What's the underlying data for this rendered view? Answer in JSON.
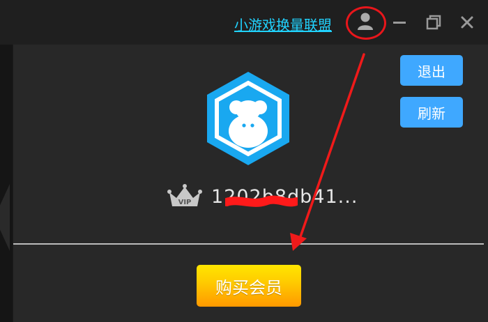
{
  "header": {
    "link_text": "小游戏换量联盟",
    "buttons": {
      "user_icon": "user-icon",
      "minimize_icon": "minimize-icon",
      "restore_icon": "restore-icon",
      "close_icon": "close-icon"
    }
  },
  "panel": {
    "avatar_icon": "monkey-hexagon-avatar",
    "logout_label": "退出",
    "refresh_label": "刷新",
    "vip_badge": "VIP",
    "username": "1202b8db41...",
    "buy_label": "购买会员"
  },
  "colors": {
    "link": "#21d3ff",
    "blue_button": "#3fa8ff",
    "buy_gradient_top": "#ffe600",
    "buy_gradient_bottom": "#ff9900",
    "annotation": "#e8161b",
    "panel_bg": "#282828"
  }
}
